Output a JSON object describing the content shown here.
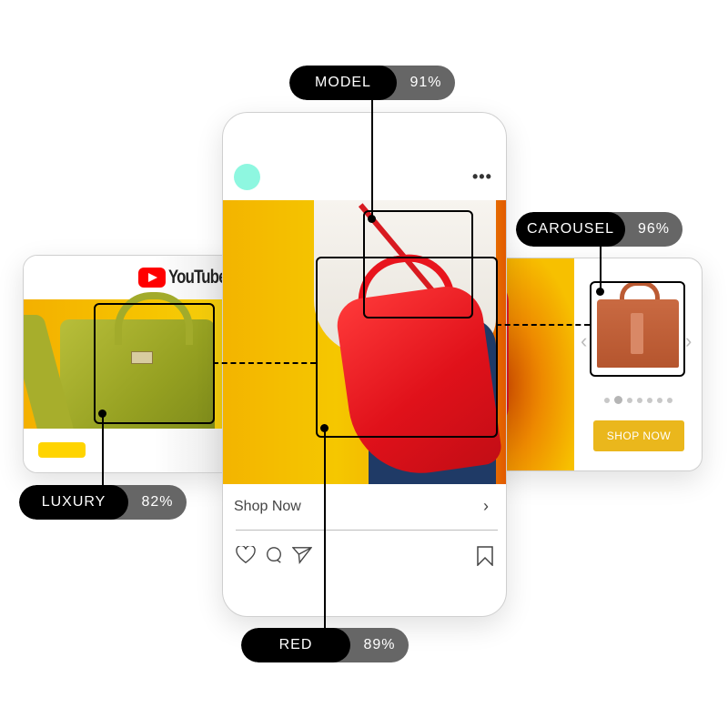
{
  "annotations": [
    {
      "id": "model",
      "label": "MODEL",
      "confidence": "91%"
    },
    {
      "id": "carousel",
      "label": "CAROUSEL",
      "confidence": "96%"
    },
    {
      "id": "luxury",
      "label": "LUXURY",
      "confidence": "82%"
    },
    {
      "id": "red",
      "label": "RED",
      "confidence": "89%"
    }
  ],
  "youtube_card": {
    "brand": "YouTube"
  },
  "instagram_card": {
    "more_icon": "•••",
    "cta_label": "Shop Now",
    "cta_chevron": "›",
    "actions": [
      "heart-icon",
      "comment-icon",
      "share-icon",
      "bookmark-icon"
    ]
  },
  "carousel_card": {
    "prev": "‹",
    "next": "›",
    "button_label": "SHOP NOW",
    "pages": 7,
    "active_page": 2
  },
  "colors": {
    "accent_yellow": "#eab71c",
    "avatar": "#8ef7e0",
    "label_dark": "#000000",
    "label_pct": "#666666"
  }
}
